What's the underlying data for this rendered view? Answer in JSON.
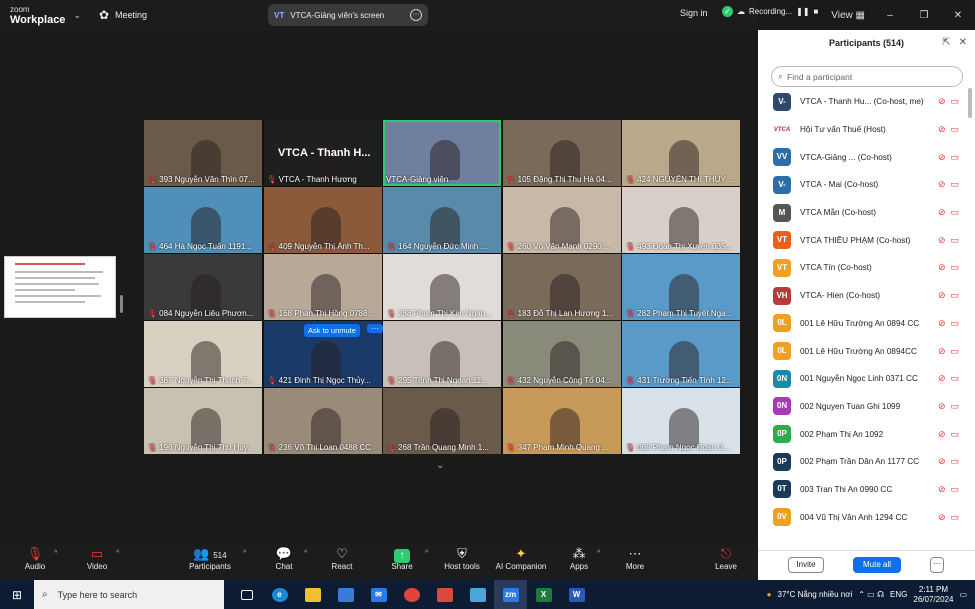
{
  "app": {
    "logo_top": "zoom",
    "logo_bottom": "Workplace",
    "meeting_label": "Meeting",
    "screen_pill": "VTCA-Giảng viên's screen",
    "screen_pill_icon": "VT",
    "signin": "Sign in",
    "recording": "Recording...",
    "view": "View"
  },
  "grid": {
    "big_name": "VTCA - Thanh H...",
    "ask_to_unmute": "Ask to unmute",
    "ask_more": "···",
    "tiles": [
      {
        "name": "393 Nguyễn Văn Thìn 07...",
        "color": "#6b5a48",
        "muted": true
      },
      {
        "name": "VTCA - Thanh Hương",
        "color": "#1f1f1f",
        "muted": true
      },
      {
        "name": "VTCA-Giảng viên",
        "color": "#6e7fa0",
        "muted": false,
        "active": true
      },
      {
        "name": "105 Đặng Thị Thu Hà 04...",
        "color": "#7a6a5a",
        "muted": true
      },
      {
        "name": "424 NGUYỄN THỊ THUỶ ...",
        "color": "#b9a98a",
        "muted": true
      },
      {
        "name": "464 Hà Ngọc Tuấn 1191...",
        "color": "#4f8fb8",
        "muted": true
      },
      {
        "name": "409 Nguyễn Thị Ánh Th...",
        "color": "#8a5a3a",
        "muted": true
      },
      {
        "name": "164 Nguyễn Đức Minh ...",
        "color": "#5a8aaa",
        "muted": true
      },
      {
        "name": "260 Võ Văn Mạnh 0290 ...",
        "color": "#c8b8a8",
        "muted": true
      },
      {
        "name": "493 Đoàn Thị Xuyến 035...",
        "color": "#d8d0c8",
        "muted": true
      },
      {
        "name": "084 Nguyễn Liêu Phươn...",
        "color": "#3a3a3a",
        "muted": true
      },
      {
        "name": "168 Phan Thị Hồng 0788...",
        "color": "#b8a898",
        "muted": true
      },
      {
        "name": "288 Phạm Thị Kim Ngân...",
        "color": "#e0ddd8",
        "muted": true
      },
      {
        "name": "183 Đỗ Thị Lan Hương 1...",
        "color": "#7a6a5a",
        "muted": true
      },
      {
        "name": "282 Phạm Thị Tuyết Nga...",
        "color": "#5a9ac8",
        "muted": true
      },
      {
        "name": "367 Nguyễn Thị Thanh T...",
        "color": "#d8d0c0",
        "muted": true
      },
      {
        "name": "421 Đinh Thị Ngọc Thủy...",
        "color": "#1a3a6a",
        "muted": true
      },
      {
        "name": "295 Trịnh Thị Ngoan 11...",
        "color": "#c8c0b8",
        "muted": true
      },
      {
        "name": "432 Nguyễn Công Tố 04...",
        "color": "#8a8a7a",
        "muted": true
      },
      {
        "name": "431 Trương Tiến Tình 12...",
        "color": "#5a9ac8",
        "muted": true
      },
      {
        "name": "196 Nguyễn Thị Thu Huy...",
        "color": "#c8c0b0",
        "muted": true
      },
      {
        "name": "236 Võ Thị Loan 0488 CC",
        "color": "#9a8a7a",
        "muted": true
      },
      {
        "name": "268 Trần Quang Minh 1...",
        "color": "#6a5a4a",
        "muted": true
      },
      {
        "name": "347 Phạm Minh Quang ...",
        "color": "#c89a5a",
        "muted": true
      },
      {
        "name": "068 Phạm Ngọc Đoàn 0...",
        "color": "#d8e0e8",
        "muted": true
      }
    ]
  },
  "panel": {
    "title": "Participants (514)",
    "search_placeholder": "Find a participant",
    "invite": "Invite",
    "mute_all": "Mute all",
    "more": "···",
    "participants": [
      {
        "initials": "V-",
        "color": "#2d4a6e",
        "name": "VTCA - Thanh Hu... (Co-host, me)"
      },
      {
        "initials": "VTCA",
        "color": "#ffffff",
        "name": "Hội Tư vấn Thuế (Host)"
      },
      {
        "initials": "VV",
        "color": "#2d6ea8",
        "name": "VTCA-Giảng ... (Co-host)"
      },
      {
        "initials": "V-",
        "color": "#2d6ea8",
        "name": "VTCA - Mai (Co-host)"
      },
      {
        "initials": "M",
        "color": "#555555",
        "name": "VTCA Mẫn (Co-host)"
      },
      {
        "initials": "VT",
        "color": "#e8601c",
        "name": "VTCA THIỀU PHẠM (Co-host)"
      },
      {
        "initials": "VT",
        "color": "#f0a020",
        "name": "VTCA Tín (Co-host)"
      },
      {
        "initials": "VH",
        "color": "#b83a3a",
        "name": "VTCA- Hien (Co-host)"
      },
      {
        "initials": "0L",
        "color": "#f0a020",
        "name": "001 Lê Hữu Trường An 0894 CC"
      },
      {
        "initials": "0L",
        "color": "#f0a020",
        "name": "001 Lê Hữu Trường An 0894CC"
      },
      {
        "initials": "0N",
        "color": "#1a8aa8",
        "name": "001 Nguyễn Ngọc Linh 0371 CC"
      },
      {
        "initials": "0N",
        "color": "#a83ab8",
        "name": "002 Nguyen Tuan Ghi 1099"
      },
      {
        "initials": "0P",
        "color": "#2eab4a",
        "name": "002 Phạm Thị An 1092"
      },
      {
        "initials": "0P",
        "color": "#1a3a5a",
        "name": "002 Phạm Trần Dân An 1177 CC"
      },
      {
        "initials": "0T",
        "color": "#1a3a5a",
        "name": "003 Tran Thi An 0990 CC"
      },
      {
        "initials": "0V",
        "color": "#f0a020",
        "name": "004 Vũ Thị Vân Anh 1294 CC"
      }
    ]
  },
  "toolbar": {
    "audio": "Audio",
    "video": "Video",
    "participants": "Participants",
    "participants_count": "514",
    "chat": "Chat",
    "react": "React",
    "share": "Share",
    "host_tools": "Host tools",
    "ai_companion": "AI Companion",
    "apps": "Apps",
    "more": "More",
    "leave": "Leave"
  },
  "taskbar": {
    "search_placeholder": "Type here to search",
    "weather": "37°C  Nắng nhiều nơi",
    "lang": "ENG",
    "time": "2:11 PM",
    "date": "26/07/2024"
  }
}
